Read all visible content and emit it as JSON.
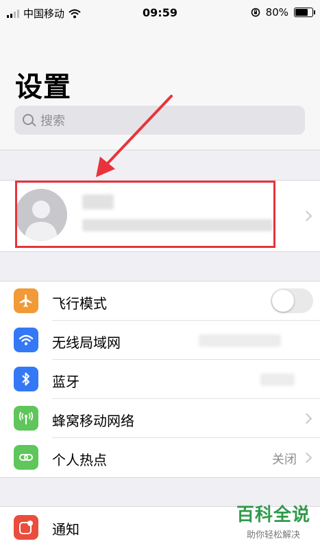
{
  "status_bar": {
    "carrier": "中国移动",
    "time": "09:59",
    "battery_percent": 80,
    "battery_text": "80%"
  },
  "header": {
    "title": "设置",
    "search_placeholder": "搜索"
  },
  "settings": [
    {
      "label": "飞行模式",
      "icon": "airplane-icon",
      "color": "#f19a37",
      "control": "toggle",
      "on": false
    },
    {
      "label": "无线局域网",
      "icon": "wifi-icon",
      "color": "#3478f6",
      "control": "none"
    },
    {
      "label": "蓝牙",
      "icon": "bluetooth-icon",
      "color": "#3478f6",
      "control": "none"
    },
    {
      "label": "蜂窝移动网络",
      "icon": "antenna-icon",
      "color": "#5ec65a",
      "control": "chevron"
    },
    {
      "label": "个人热点",
      "icon": "hotspot-icon",
      "color": "#5ec65a",
      "control": "chevron",
      "value": "关闭"
    }
  ],
  "notifications": {
    "label": "通知",
    "icon": "notification-icon",
    "color": "#ea4d3d"
  },
  "watermark": {
    "main": "百科全说",
    "sub": "助你轻松解决"
  },
  "colors": {
    "highlight": "#e8333a",
    "watermark": "#2f9a4b"
  }
}
